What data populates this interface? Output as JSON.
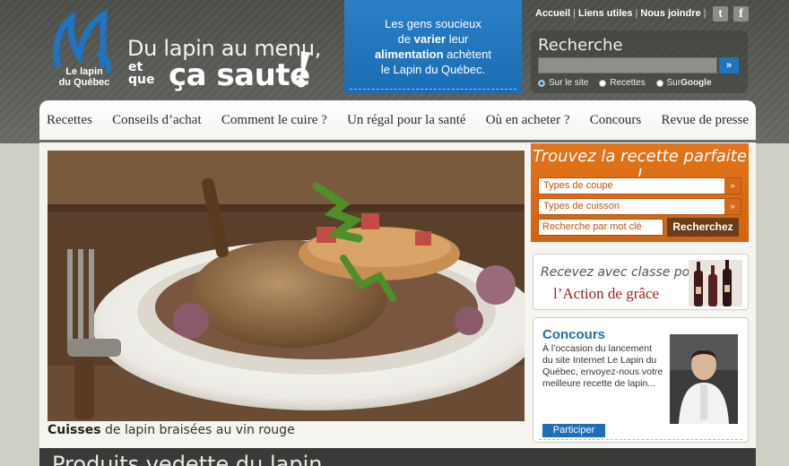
{
  "brand": {
    "logo_line1": "Le lapin",
    "logo_line2": "du Québec",
    "slogan_line1": "Du lapin au menu,",
    "slogan_small_1": "et",
    "slogan_small_2": "que",
    "slogan_line2": "ça saute",
    "slogan_bang": "!",
    "blue_accent": "#1f74bf",
    "orange_accent": "#dd6d18"
  },
  "blue_box": {
    "line1": "Les gens soucieux",
    "line2_pre": "de ",
    "line2_bold": "varier",
    "line2_post": " leur",
    "line3_bold": "alimentation",
    "line3_post": " achètent",
    "line4": "le Lapin du Québec."
  },
  "top_links": {
    "home": "Accueil",
    "links": "Liens utiles",
    "contact": "Nous joindre",
    "sep": "|",
    "twitter_icon": "t",
    "facebook_icon": "f"
  },
  "search": {
    "title": "Recherche",
    "go": "»",
    "placeholder": "",
    "options": [
      {
        "label": "Sur le site",
        "checked": true
      },
      {
        "label": "Recettes",
        "checked": false
      },
      {
        "label_pre": "Sur ",
        "label_bold": "Google",
        "checked": false
      }
    ]
  },
  "nav": {
    "items": [
      "Recettes",
      "Conseils d’achat",
      "Comment le cuire ?",
      "Un régal pour la santé",
      "Où en acheter ?",
      "Concours",
      "Revue de presse"
    ]
  },
  "hero": {
    "caption_bold": "Cuisses",
    "caption_rest": " de lapin braisées au vin rouge"
  },
  "finder": {
    "title": "Trouvez la recette parfaite !",
    "select1": "Types de coupe",
    "select2": "Types de cuisson",
    "keyword_placeholder": "Recherche par mot clé",
    "button": "Recherchez",
    "chevron": "»"
  },
  "promo": {
    "line1": "Recevez avec classe pour",
    "line2": "l’Action de grâce"
  },
  "contest": {
    "title": "Concours",
    "text": "À l’occasion du lancement du site Internet Le Lapin du Québec, envoyez-nous votre meilleure recette de lapin...",
    "button": "Participer"
  },
  "bottom": {
    "text": "Produits vedette du lapin"
  }
}
